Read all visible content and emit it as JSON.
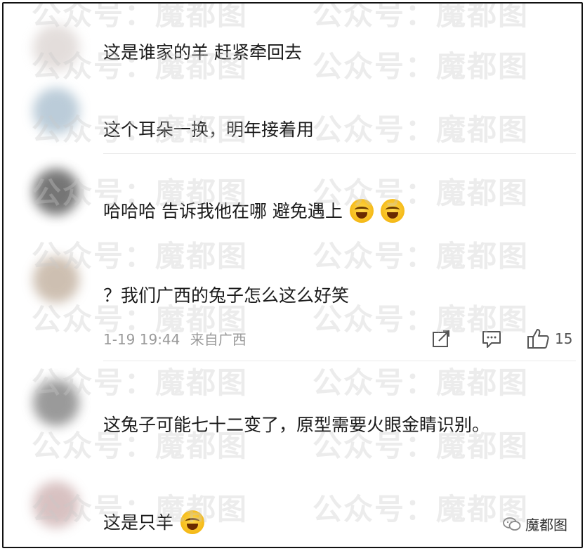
{
  "watermark": {
    "text": "公众号：魔都图"
  },
  "comments": [
    {
      "text": "这是谁家的羊  赶紧牵回去"
    },
    {
      "text": "这个耳朵一换，明年接着用"
    },
    {
      "text": "哈哈哈   告诉我他在哪  避免遇上",
      "emoji": [
        "laughing-crying-emoji",
        "laughing-crying-emoji"
      ]
    },
    {
      "text": "？我们广西的兔子怎么这么好笑"
    },
    {
      "text": "这兔子可能七十二变了，原型需要火眼金睛识别。"
    },
    {
      "text": "这是只羊",
      "emoji": [
        "laughing-crying-emoji"
      ]
    }
  ],
  "meta": {
    "time": "1-19 19:44",
    "location": "来自广西"
  },
  "actions": {
    "like_count": "15"
  },
  "logo": {
    "text": "魔都图"
  }
}
